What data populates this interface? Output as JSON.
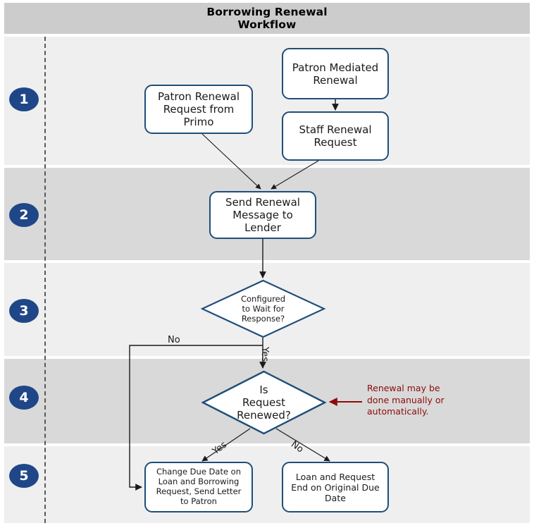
{
  "header": {
    "title": "Borrowing Renewal\nWorkflow"
  },
  "colors": {
    "header_band": "#cccccc",
    "band_light": "#efefef",
    "band_dark": "#d9d9d9",
    "node_border": "#1f4e79",
    "badge_fill": "#1f4788",
    "badge_text": "#ffffff",
    "annotation_text": "#8b0b0b",
    "annotation_arrow": "#8b0b0b",
    "connector": "#1a1a1a",
    "divider": "#595959"
  },
  "lanes": [
    {
      "number": "1",
      "shade": "light"
    },
    {
      "number": "2",
      "shade": "dark"
    },
    {
      "number": "3",
      "shade": "light"
    },
    {
      "number": "4",
      "shade": "dark"
    },
    {
      "number": "5",
      "shade": "light"
    }
  ],
  "nodes": {
    "patron_renewal_request": "Patron Renewal\nRequest from\nPrimo",
    "patron_mediated_renewal": "Patron Mediated\nRenewal",
    "staff_renewal_request": "Staff Renewal\nRequest",
    "send_renewal_message": "Send Renewal\nMessage to\nLender",
    "configured_to_wait": "Configured\nto Wait for\nResponse?",
    "is_request_renewed": "Is\nRequest\nRenewed?",
    "change_due_date": "Change Due Date on\nLoan and Borrowing\nRequest, Send Letter\nto Patron",
    "loan_request_end": "Loan and Request\nEnd on Original Due\nDate"
  },
  "edge_labels": {
    "wait_no": "No",
    "wait_yes": "Yes",
    "renewed_yes": "Yes",
    "renewed_no": "No"
  },
  "annotation": {
    "text": "Renewal may be\ndone manually or\nautomatically."
  }
}
